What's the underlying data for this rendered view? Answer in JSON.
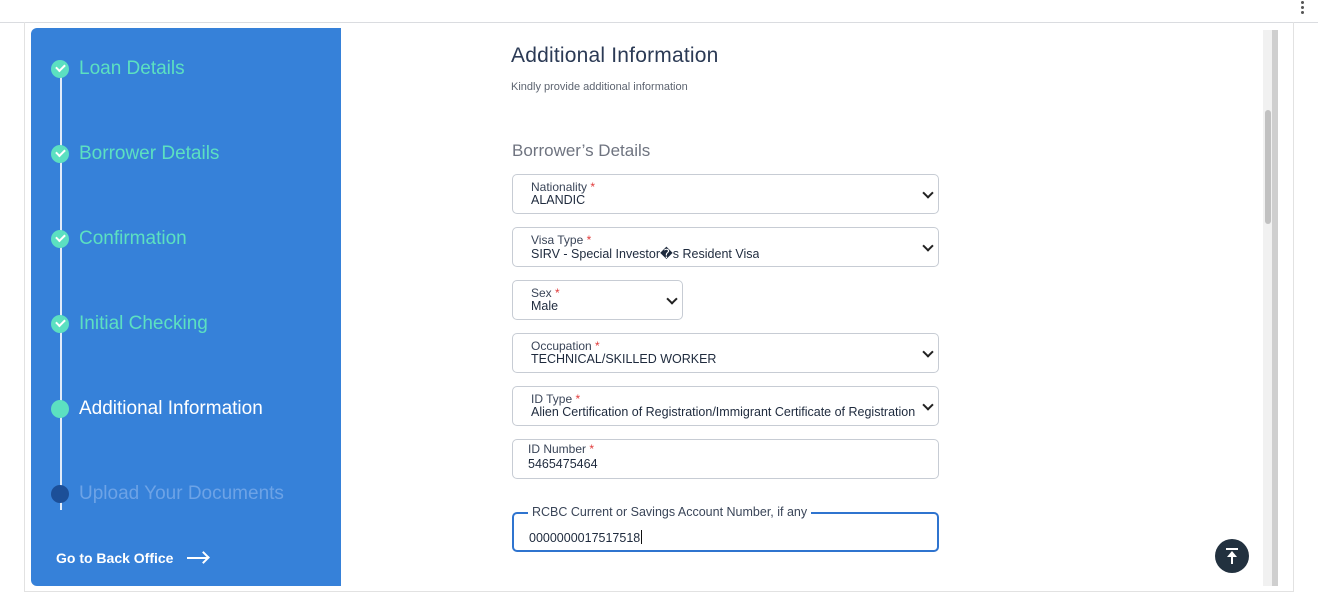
{
  "sidebar": {
    "steps": [
      {
        "label": "Loan Details",
        "state": "done"
      },
      {
        "label": "Borrower Details",
        "state": "done"
      },
      {
        "label": "Confirmation",
        "state": "done"
      },
      {
        "label": "Initial Checking",
        "state": "done"
      },
      {
        "label": "Additional Information",
        "state": "current"
      },
      {
        "label": "Upload Your Documents",
        "state": "pending"
      }
    ],
    "back_office_label": "Go to Back Office"
  },
  "main": {
    "title": "Additional Information",
    "subtitle": "Kindly provide additional information",
    "section_title": "Borrower’s Details",
    "fields": {
      "nationality": {
        "label": "Nationality",
        "required": "*",
        "value": "ALANDIC"
      },
      "visa_type": {
        "label": "Visa Type",
        "required": "*",
        "value": "SIRV - Special Investor�s Resident Visa"
      },
      "sex": {
        "label": "Sex",
        "required": "*",
        "value": "Male"
      },
      "occupation": {
        "label": "Occupation",
        "required": "*",
        "value": "TECHNICAL/SKILLED WORKER"
      },
      "id_type": {
        "label": "ID Type",
        "required": "*",
        "value": "Alien Certification of Registration/Immigrant Certificate of Registration"
      },
      "id_number": {
        "label": "ID Number",
        "required": "*",
        "value": "5465475464"
      },
      "account_number": {
        "label": "RCBC Current or Savings Account Number, if any",
        "value": "0000000017517518"
      }
    }
  },
  "colors": {
    "sidebar_bg": "#3681d9",
    "step_done": "#5ce0c1",
    "field_focus": "#2f74cf",
    "required": "#e03b3b"
  },
  "icons": [
    "check-icon",
    "arrow-right-icon",
    "chevron-down-icon",
    "back-to-top-icon",
    "more-vert-icon"
  ]
}
